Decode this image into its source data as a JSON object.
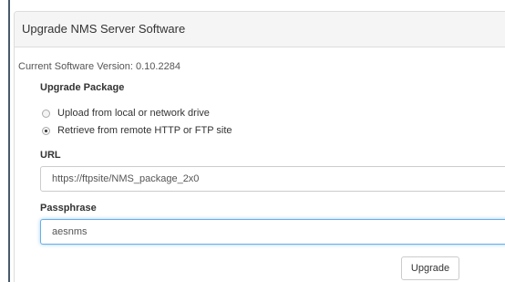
{
  "panel": {
    "title": "Upgrade NMS Server Software"
  },
  "current_version": {
    "text": "Current Software Version: 0.10.2284"
  },
  "upgrade_package": {
    "label": "Upgrade Package",
    "options": [
      {
        "label": "Upload from local or network drive",
        "checked": false
      },
      {
        "label": "Retrieve from remote HTTP or FTP site",
        "checked": true
      }
    ]
  },
  "url": {
    "label": "URL",
    "value": "https://ftpsite/NMS_package_2x0"
  },
  "passphrase": {
    "label": "Passphrase",
    "value": "aesnms"
  },
  "actions": {
    "upgrade_label": "Upgrade"
  },
  "colors": {
    "focus_border": "#66afe9",
    "heading_bg": "#f5f5f5",
    "sidebar_border": "#4a5a6a"
  }
}
